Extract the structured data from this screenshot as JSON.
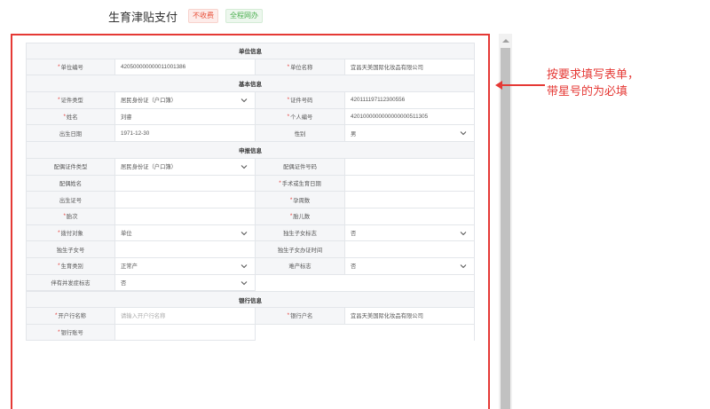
{
  "header": {
    "title": "生育津贴支付",
    "tag_red": "不收费",
    "tag_green": "全程网办"
  },
  "annotation": {
    "line1": "按要求填写表单，",
    "line2": "带星号的为必填"
  },
  "sections": {
    "unit": "单位信息",
    "basic": "基本信息",
    "declare": "申报信息",
    "bank": "银行信息"
  },
  "fields": {
    "unit_code": {
      "label": "单位编号",
      "value": "420500000000011001386"
    },
    "unit_name": {
      "label": "单位名称",
      "value": "宜昌天美国际化妆品有限公司"
    },
    "id_type": {
      "label": "证件类型",
      "value": "居民身份证（户口簿）"
    },
    "id_no": {
      "label": "证件号码",
      "value": "420111197112300556"
    },
    "name": {
      "label": "姓名",
      "value": "刘睿"
    },
    "person_no": {
      "label": "个人编号",
      "value": "4201000000000000000511305"
    },
    "birth_date": {
      "label": "出生日期",
      "value": "1971-12-30"
    },
    "gender": {
      "label": "性别",
      "value": "男"
    },
    "spouse_id_type": {
      "label": "配偶证件类型",
      "value": "居民身份证（户口簿）"
    },
    "spouse_id_no": {
      "label": "配偶证件号码",
      "value": ""
    },
    "spouse_name": {
      "label": "配偶姓名",
      "value": ""
    },
    "surgery_date": {
      "label": "手术或生育日期",
      "value": ""
    },
    "birth_cert": {
      "label": "出生证号",
      "value": ""
    },
    "pregnancy_weeks": {
      "label": "孕周数",
      "value": ""
    },
    "birth_order": {
      "label": "胎次",
      "value": ""
    },
    "baby_count": {
      "label": "胎儿数",
      "value": ""
    },
    "pay_target": {
      "label": "拨付对象",
      "value": "单位"
    },
    "only_child_flag": {
      "label": "独生子女标志",
      "value": "否"
    },
    "only_child_no": {
      "label": "独生子女号",
      "value": ""
    },
    "only_child_date": {
      "label": "独生子女办证时间",
      "value": ""
    },
    "birth_type": {
      "label": "生育类别",
      "value": "正常产"
    },
    "dystocia_flag": {
      "label": "难产标志",
      "value": "否"
    },
    "complication_flag": {
      "label": "伴有并发症标志",
      "value": "否"
    },
    "bank_name": {
      "label": "开户行名称",
      "placeholder": "请输入开户行名称"
    },
    "account_name": {
      "label": "银行户名",
      "value": "宜昌天美国际化妆品有限公司"
    },
    "account_no": {
      "label": "银行账号",
      "value": ""
    }
  },
  "colors": {
    "required_star": "#e53935",
    "highlight_border": "#e53935",
    "label_bg": "#f5f6f8"
  },
  "icons": [
    "chevron-down-icon",
    "scroll-up-icon",
    "arrow-left-icon"
  ]
}
